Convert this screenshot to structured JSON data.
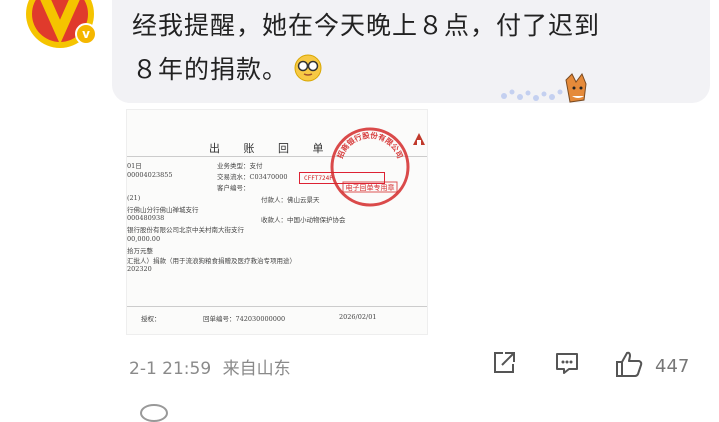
{
  "comment": {
    "text_line1": "经我提醒，她在今天晚上８点，付了迟到",
    "text_line2": "８年的捐款。",
    "emoji_icon": "glasses-face-emoji",
    "date": "2-1 21:59",
    "location": "来自山东",
    "like_count": "447"
  },
  "receipt": {
    "title": "出 账 回 单",
    "lines": {
      "l1": "01日",
      "l2": "00004023855",
      "l3": "业务类型：支付",
      "l4": "交易流水：C03470000",
      "l5": "客户编号：",
      "l6": "(21)",
      "l7": "付款人：佛山云景天",
      "l8": "行佛山分行佛山禅城支行",
      "l9": "000480938",
      "l10": "收款人：中国小动物保护协会",
      "l11": "银行股份有限公司北京中关村南大街支行",
      "l12": "00,000.00",
      "l13": "拾万元整",
      "l14": "汇批人）捐款（用于流浪狗粮食捐赠及医疗救治专项用途）",
      "l15": "202320",
      "l16": "授权：",
      "l17": "回单编号：742030000000",
      "l18": "2026/02/01",
      "box_text": "CFFT724P"
    },
    "stamp_text_top": "招商银行股份有限公司",
    "stamp_text_bottom": "电子回单专用章"
  },
  "colors": {
    "bubble": "#f2f2f5",
    "meta_text": "#8a8a8a",
    "stamp_red": "#d42a2a",
    "avatar_gold": "#f0b400",
    "avatar_red": "#d8302a"
  }
}
